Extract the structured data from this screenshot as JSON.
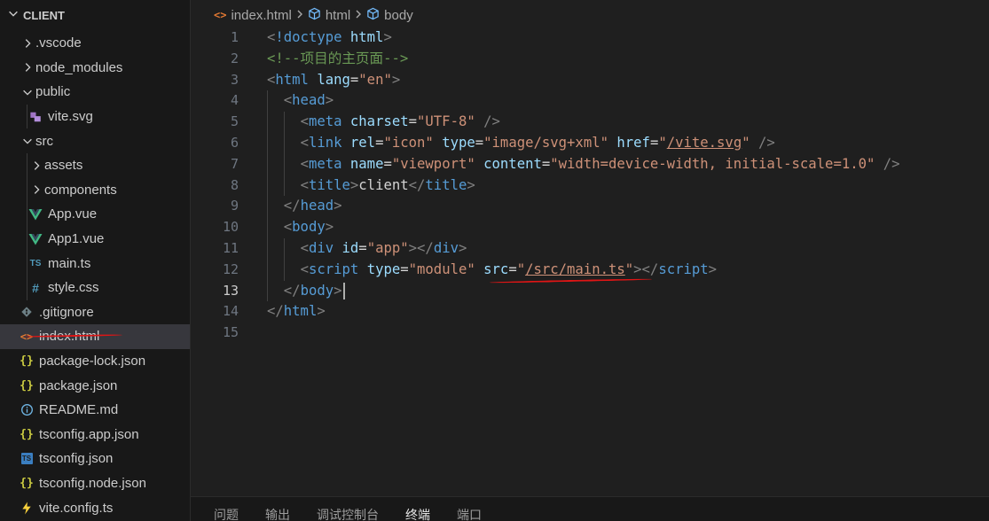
{
  "sidebar": {
    "title": "CLIENT",
    "items": [
      {
        "label": ".vscode",
        "kind": "folder",
        "depth": 0,
        "expanded": false,
        "icon": "chevron-right-icon"
      },
      {
        "label": "node_modules",
        "kind": "folder",
        "depth": 0,
        "expanded": false,
        "icon": "chevron-right-icon"
      },
      {
        "label": "public",
        "kind": "folder",
        "depth": 0,
        "expanded": true,
        "icon": "chevron-down-icon"
      },
      {
        "label": "vite.svg",
        "kind": "file",
        "depth": 1,
        "icon": "svg-file-icon"
      },
      {
        "label": "src",
        "kind": "folder",
        "depth": 0,
        "expanded": true,
        "icon": "chevron-down-icon"
      },
      {
        "label": "assets",
        "kind": "folder",
        "depth": 1,
        "expanded": false,
        "icon": "chevron-right-icon"
      },
      {
        "label": "components",
        "kind": "folder",
        "depth": 1,
        "expanded": false,
        "icon": "chevron-right-icon"
      },
      {
        "label": "App.vue",
        "kind": "file",
        "depth": 1,
        "icon": "vue-file-icon"
      },
      {
        "label": "App1.vue",
        "kind": "file",
        "depth": 1,
        "icon": "vue-file-icon"
      },
      {
        "label": "main.ts",
        "kind": "file",
        "depth": 1,
        "icon": "ts-file-icon",
        "icon_text": "TS"
      },
      {
        "label": "style.css",
        "kind": "file",
        "depth": 1,
        "icon": "css-file-icon",
        "icon_text": "#"
      },
      {
        "label": ".gitignore",
        "kind": "file",
        "depth": 0,
        "icon": "git-file-icon"
      },
      {
        "label": "index.html",
        "kind": "file",
        "depth": 0,
        "icon": "html-file-icon",
        "icon_text": "<>",
        "selected": true
      },
      {
        "label": "package-lock.json",
        "kind": "file",
        "depth": 0,
        "icon": "json-file-icon",
        "icon_text": "{}"
      },
      {
        "label": "package.json",
        "kind": "file",
        "depth": 0,
        "icon": "json-file-icon",
        "icon_text": "{}"
      },
      {
        "label": "README.md",
        "kind": "file",
        "depth": 0,
        "icon": "info-file-icon",
        "icon_text": "ⓘ"
      },
      {
        "label": "tsconfig.app.json",
        "kind": "file",
        "depth": 0,
        "icon": "json-file-icon",
        "icon_text": "{}"
      },
      {
        "label": "tsconfig.json",
        "kind": "file",
        "depth": 0,
        "icon": "tsconfig-file-icon",
        "icon_text": "TS"
      },
      {
        "label": "tsconfig.node.json",
        "kind": "file",
        "depth": 0,
        "icon": "json-file-icon",
        "icon_text": "{}"
      },
      {
        "label": "vite.config.ts",
        "kind": "file",
        "depth": 0,
        "icon": "vite-file-icon"
      }
    ]
  },
  "breadcrumb": {
    "file": "index.html",
    "file_icon": "<>",
    "items": [
      "html",
      "body"
    ]
  },
  "editor": {
    "current_line": 13,
    "lines": [
      {
        "n": "1",
        "tokens": [
          [
            "punc",
            "<"
          ],
          [
            "tag",
            "!doctype"
          ],
          [
            "text",
            " "
          ],
          [
            "attr",
            "html"
          ],
          [
            "punc",
            ">"
          ]
        ]
      },
      {
        "n": "2",
        "tokens": [
          [
            "comment",
            "<!--项目的主页面-->"
          ]
        ]
      },
      {
        "n": "3",
        "tokens": [
          [
            "punc",
            "<"
          ],
          [
            "tag",
            "html"
          ],
          [
            "text",
            " "
          ],
          [
            "attr",
            "lang"
          ],
          [
            "text",
            "="
          ],
          [
            "str",
            "\"en\""
          ],
          [
            "punc",
            ">"
          ]
        ]
      },
      {
        "n": "4",
        "indent": 1,
        "tokens": [
          [
            "punc",
            "<"
          ],
          [
            "tag",
            "head"
          ],
          [
            "punc",
            ">"
          ]
        ]
      },
      {
        "n": "5",
        "indent": 2,
        "tokens": [
          [
            "punc",
            "<"
          ],
          [
            "tag",
            "meta"
          ],
          [
            "text",
            " "
          ],
          [
            "attr",
            "charset"
          ],
          [
            "text",
            "="
          ],
          [
            "str",
            "\"UTF-8\""
          ],
          [
            "text",
            " "
          ],
          [
            "punc",
            "/>"
          ]
        ]
      },
      {
        "n": "6",
        "indent": 2,
        "tokens": [
          [
            "punc",
            "<"
          ],
          [
            "tag",
            "link"
          ],
          [
            "text",
            " "
          ],
          [
            "attr",
            "rel"
          ],
          [
            "text",
            "="
          ],
          [
            "str",
            "\"icon\""
          ],
          [
            "text",
            " "
          ],
          [
            "attr",
            "type"
          ],
          [
            "text",
            "="
          ],
          [
            "str",
            "\"image/svg+xml\""
          ],
          [
            "text",
            " "
          ],
          [
            "attr",
            "href"
          ],
          [
            "text",
            "="
          ],
          [
            "str",
            "\""
          ],
          [
            "strlink",
            "/vite.svg"
          ],
          [
            "str",
            "\""
          ],
          [
            "text",
            " "
          ],
          [
            "punc",
            "/>"
          ]
        ]
      },
      {
        "n": "7",
        "indent": 2,
        "tokens": [
          [
            "punc",
            "<"
          ],
          [
            "tag",
            "meta"
          ],
          [
            "text",
            " "
          ],
          [
            "attr",
            "name"
          ],
          [
            "text",
            "="
          ],
          [
            "str",
            "\"viewport\""
          ],
          [
            "text",
            " "
          ],
          [
            "attr",
            "content"
          ],
          [
            "text",
            "="
          ],
          [
            "str",
            "\"width=device-width, initial-scale=1.0\""
          ],
          [
            "text",
            " "
          ],
          [
            "punc",
            "/>"
          ]
        ]
      },
      {
        "n": "8",
        "indent": 2,
        "tokens": [
          [
            "punc",
            "<"
          ],
          [
            "tag",
            "title"
          ],
          [
            "punc",
            ">"
          ],
          [
            "text",
            "client"
          ],
          [
            "punc",
            "</"
          ],
          [
            "tag",
            "title"
          ],
          [
            "punc",
            ">"
          ]
        ]
      },
      {
        "n": "9",
        "indent": 1,
        "tokens": [
          [
            "punc",
            "</"
          ],
          [
            "tag",
            "head"
          ],
          [
            "punc",
            ">"
          ]
        ]
      },
      {
        "n": "10",
        "indent": 1,
        "tokens": [
          [
            "punc",
            "<"
          ],
          [
            "tag",
            "body"
          ],
          [
            "punc",
            ">"
          ]
        ]
      },
      {
        "n": "11",
        "indent": 2,
        "tokens": [
          [
            "punc",
            "<"
          ],
          [
            "tag",
            "div"
          ],
          [
            "text",
            " "
          ],
          [
            "attr",
            "id"
          ],
          [
            "text",
            "="
          ],
          [
            "str",
            "\"app\""
          ],
          [
            "punc",
            "></"
          ],
          [
            "tag",
            "div"
          ],
          [
            "punc",
            ">"
          ]
        ]
      },
      {
        "n": "12",
        "indent": 2,
        "tokens": [
          [
            "punc",
            "<"
          ],
          [
            "tag",
            "script"
          ],
          [
            "text",
            " "
          ],
          [
            "attr",
            "type"
          ],
          [
            "text",
            "="
          ],
          [
            "str",
            "\"module\""
          ],
          [
            "text",
            " "
          ],
          [
            "attr",
            "src"
          ],
          [
            "text",
            "="
          ],
          [
            "str",
            "\""
          ],
          [
            "strlink",
            "/src/main.ts"
          ],
          [
            "str",
            "\""
          ],
          [
            "punc",
            "></"
          ],
          [
            "tag",
            "script"
          ],
          [
            "punc",
            ">"
          ]
        ]
      },
      {
        "n": "13",
        "indent": 1,
        "tokens": [
          [
            "punc",
            "</"
          ],
          [
            "tag",
            "body"
          ],
          [
            "punc",
            ">"
          ]
        ],
        "cursor": true
      },
      {
        "n": "14",
        "tokens": [
          [
            "punc",
            "</"
          ],
          [
            "tag",
            "html"
          ],
          [
            "punc",
            ">"
          ]
        ]
      },
      {
        "n": "15",
        "tokens": []
      }
    ]
  },
  "panel": {
    "tabs": [
      {
        "label": "问题",
        "active": false
      },
      {
        "label": "输出",
        "active": false
      },
      {
        "label": "调试控制台",
        "active": false
      },
      {
        "label": "终端",
        "active": true
      },
      {
        "label": "端口",
        "active": false
      }
    ]
  },
  "colors": {
    "annotation": "#e01515",
    "vue": "#41b883",
    "selected_row": "#37373d"
  }
}
